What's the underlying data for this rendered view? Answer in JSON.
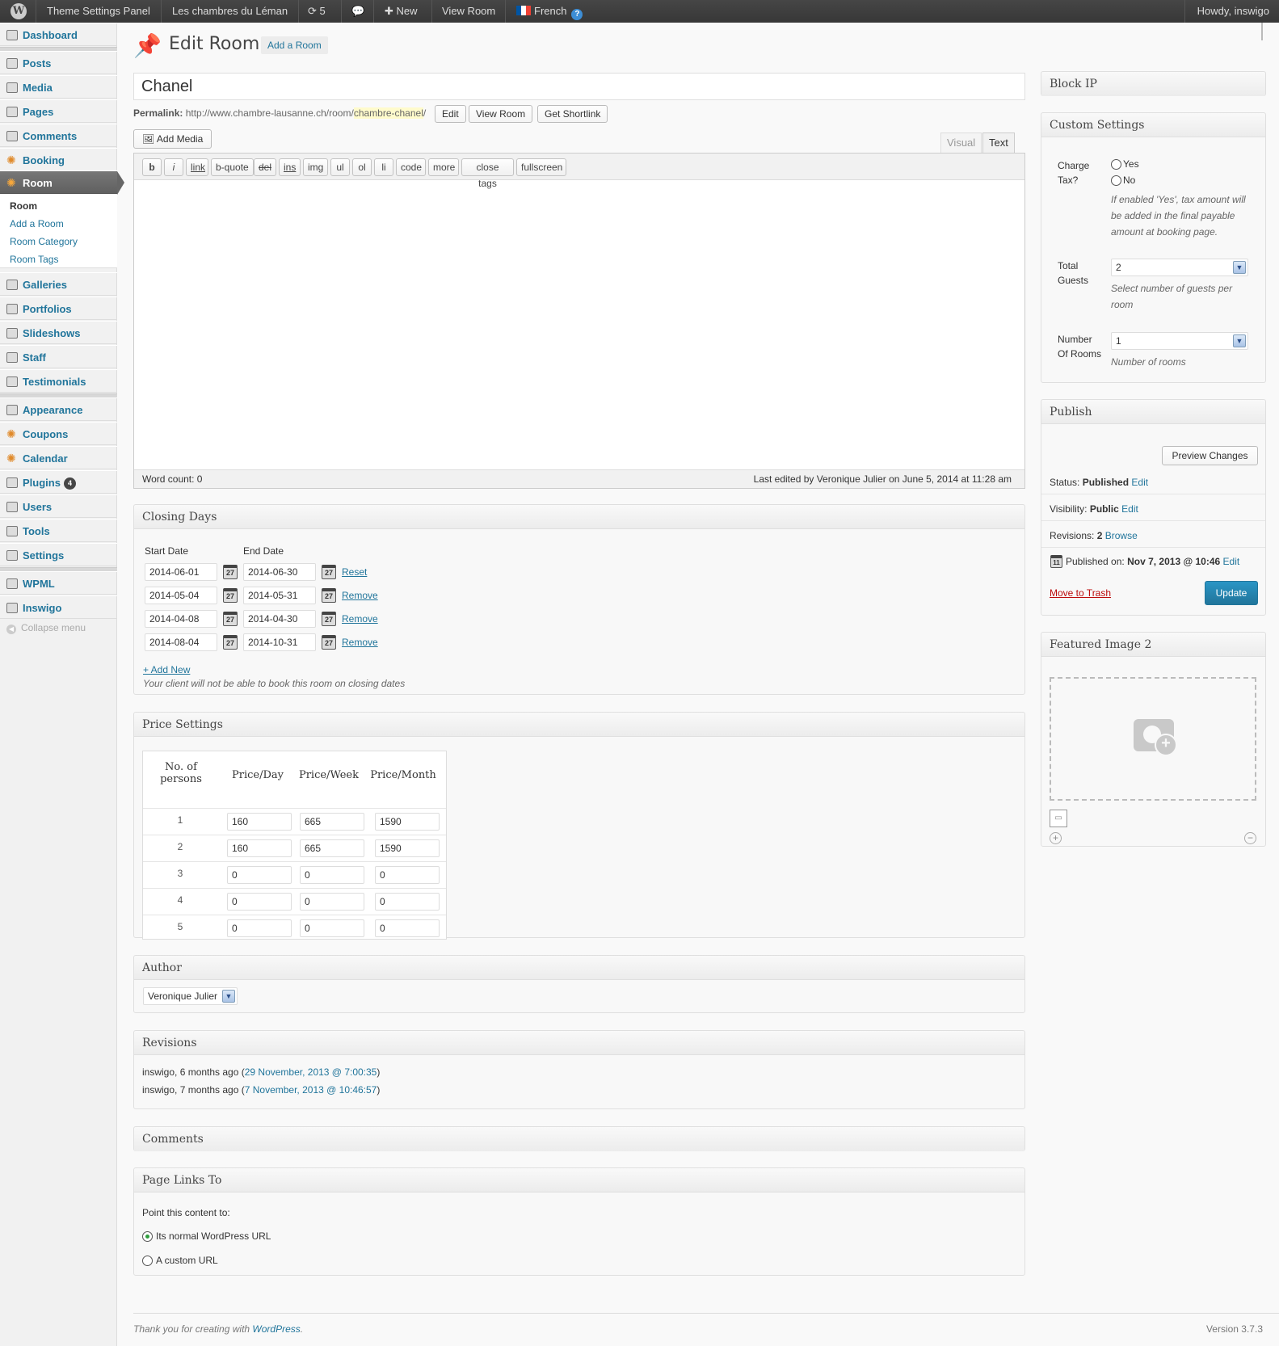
{
  "adminbar": {
    "site_settings": "Theme Settings Panel",
    "site_name": "Les chambres du Léman",
    "updates": "5",
    "new": "New",
    "view_room": "View Room",
    "language": "French",
    "howdy": "Howdy, inswigo"
  },
  "menu": {
    "dashboard": "Dashboard",
    "posts": "Posts",
    "media": "Media",
    "pages": "Pages",
    "comments": "Comments",
    "booking": "Booking",
    "room": "Room",
    "sub": {
      "room": "Room",
      "add_room": "Add a Room",
      "room_category": "Room Category",
      "room_tags": "Room Tags"
    },
    "galleries": "Galleries",
    "portfolios": "Portfolios",
    "slideshows": "Slideshows",
    "staff": "Staff",
    "testimonials": "Testimonials",
    "appearance": "Appearance",
    "coupons": "Coupons",
    "calendar": "Calendar",
    "plugins": "Plugins",
    "plugins_badge": "4",
    "users": "Users",
    "tools": "Tools",
    "settings": "Settings",
    "wpml": "WPML",
    "inswigo": "Inswigo",
    "collapse": "Collapse menu"
  },
  "header": {
    "title": "Edit Room",
    "add_new": "Add a Room"
  },
  "post": {
    "title": "Chanel",
    "permalink_label": "Permalink:",
    "permalink_base": "http://www.chambre-lausanne.ch/room/",
    "permalink_slug": "chambre-chanel",
    "permalink_end": "/",
    "edit_btn": "Edit",
    "view_btn": "View Room",
    "shortlink_btn": "Get Shortlink",
    "add_media": "Add Media"
  },
  "editor": {
    "tab_visual": "Visual",
    "tab_text": "Text",
    "buttons": [
      "b",
      "i",
      "link",
      "b-quote",
      "del",
      "ins",
      "img",
      "ul",
      "ol",
      "li",
      "code",
      "more",
      "close tags",
      "fullscreen"
    ],
    "word_count": "Word count: 0",
    "last_edited": "Last edited by Veronique Julier on June 5, 2014 at 11:28 am"
  },
  "closing_days": {
    "title": "Closing Days",
    "start_label": "Start Date",
    "end_label": "End Date",
    "cal_day": "27",
    "rows": [
      {
        "start": "2014-06-01",
        "end": "2014-06-30",
        "action": "Reset"
      },
      {
        "start": "2014-05-04",
        "end": "2014-05-31",
        "action": "Remove"
      },
      {
        "start": "2014-04-08",
        "end": "2014-04-30",
        "action": "Remove"
      },
      {
        "start": "2014-08-04",
        "end": "2014-10-31",
        "action": "Remove"
      }
    ],
    "add_new": "+ Add New",
    "note": "Your client will not be able to book this room on closing dates"
  },
  "price_settings": {
    "title": "Price Settings",
    "headers": [
      "No. of persons",
      "Price/Day",
      "Price/Week",
      "Price/Month"
    ],
    "rows": [
      {
        "persons": "1",
        "day": "160",
        "week": "665",
        "month": "1590"
      },
      {
        "persons": "2",
        "day": "160",
        "week": "665",
        "month": "1590"
      },
      {
        "persons": "3",
        "day": "0",
        "week": "0",
        "month": "0"
      },
      {
        "persons": "4",
        "day": "0",
        "week": "0",
        "month": "0"
      },
      {
        "persons": "5",
        "day": "0",
        "week": "0",
        "month": "0"
      }
    ]
  },
  "author": {
    "title": "Author",
    "value": "Veronique Julier"
  },
  "revisions": {
    "title": "Revisions",
    "items": [
      {
        "prefix": "inswigo, 6 months ago (",
        "link": "29 November, 2013 @ 7:00:35",
        "suffix": ")"
      },
      {
        "prefix": "inswigo, 7 months ago (",
        "link": "7 November, 2013 @ 10:46:57",
        "suffix": ")"
      }
    ]
  },
  "comments_box": {
    "title": "Comments"
  },
  "page_links": {
    "title": "Page Links To",
    "label": "Point this content to:",
    "opt_normal": "Its normal WordPress URL",
    "opt_custom": "A custom URL"
  },
  "block_ip": {
    "title": "Block IP"
  },
  "custom_settings": {
    "title": "Custom Settings",
    "charge_tax_label": "Charge Tax?",
    "yes": "Yes",
    "no": "No",
    "tax_note": "If enabled 'Yes', tax amount will be added in the final payable amount at booking page.",
    "total_guests_label": "Total Guests",
    "total_guests_value": "2",
    "guests_note": "Select number of guests per room",
    "rooms_label": "Number Of Rooms",
    "rooms_value": "1",
    "rooms_note": "Number of rooms"
  },
  "publish": {
    "title": "Publish",
    "preview": "Preview Changes",
    "status_label": "Status:",
    "status_value": "Published",
    "visibility_label": "Visibility:",
    "visibility_value": "Public",
    "revisions_label": "Revisions:",
    "revisions_value": "2",
    "browse": "Browse",
    "published_label": "Published on:",
    "published_value": "Nov 7, 2013 @ 10:46",
    "edit": "Edit",
    "trash": "Move to Trash",
    "update": "Update",
    "cal_day": "11"
  },
  "featured": {
    "title": "Featured Image 2"
  },
  "footer": {
    "thanks_pre": "Thank you for creating with ",
    "thanks_link": "WordPress",
    "thanks_post": ".",
    "version": "Version 3.7.3"
  }
}
